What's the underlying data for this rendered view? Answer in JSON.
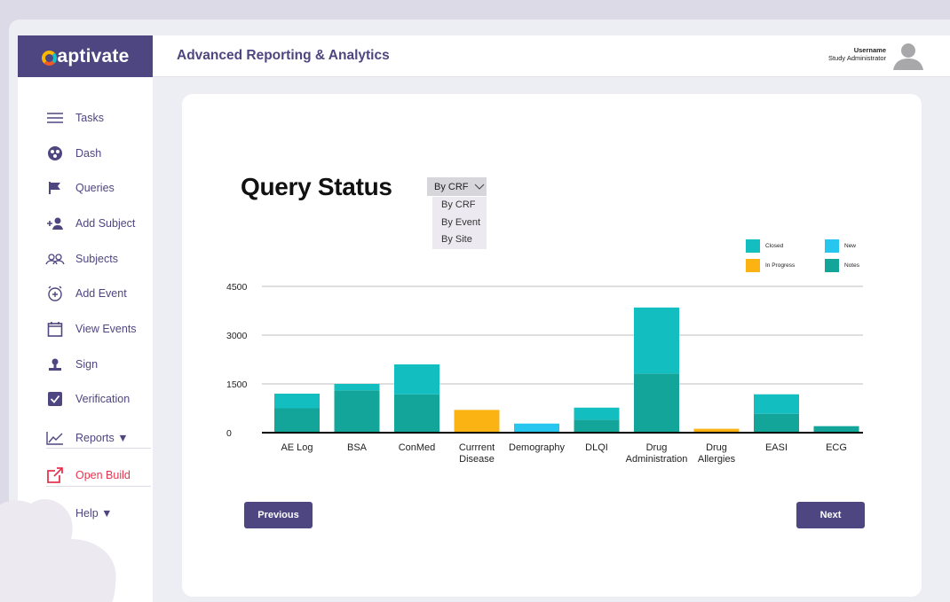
{
  "app": {
    "title": "Advanced Reporting & Analytics",
    "logo": "captivate"
  },
  "user": {
    "name": "Username",
    "role": "Study Administrator"
  },
  "sidebar": {
    "items": [
      {
        "label": "Tasks",
        "icon": "menu-icon"
      },
      {
        "label": "Dash",
        "icon": "dashboard-icon"
      },
      {
        "label": "Queries",
        "icon": "flag-icon"
      },
      {
        "label": "Add Subject",
        "icon": "add-person-icon"
      },
      {
        "label": "Subjects",
        "icon": "people-icon"
      },
      {
        "label": "Add Event",
        "icon": "add-alarm-icon"
      },
      {
        "label": "View Events",
        "icon": "calendar-icon"
      },
      {
        "label": "Sign",
        "icon": "sign-icon"
      },
      {
        "label": "Verification",
        "icon": "checkbox-icon"
      },
      {
        "label": "Reports ▼",
        "icon": "line-chart-icon"
      },
      {
        "label": "Open Build",
        "icon": "external-link-icon"
      },
      {
        "label": "Help ▼",
        "icon": "help-icon"
      }
    ]
  },
  "main": {
    "title": "Query Status",
    "dropdown": {
      "selected": "By CRF",
      "options": [
        "By CRF",
        "By Event",
        "By Site"
      ]
    },
    "buttons": {
      "previous": "Previous",
      "next": "Next"
    }
  },
  "chart_data": {
    "type": "bar",
    "stacked": true,
    "categories": [
      "AE Log",
      "BSA",
      "ConMed",
      "Currrent Disease",
      "Demography",
      "DLQI",
      "Drug Administration",
      "Drug Allergies",
      "EASI",
      "ECG"
    ],
    "category_lines": [
      [
        "AE Log"
      ],
      [
        "BSA"
      ],
      [
        "ConMed"
      ],
      [
        "Currrent",
        "Disease"
      ],
      [
        "Demography"
      ],
      [
        "DLQI"
      ],
      [
        "Drug",
        "Administration"
      ],
      [
        "Drug",
        "Allergies"
      ],
      [
        "EASI"
      ],
      [
        "ECG"
      ]
    ],
    "series": [
      {
        "name": "Notes",
        "color": "#13a59a",
        "values": [
          750,
          1300,
          1180,
          0,
          0,
          400,
          1820,
          0,
          580,
          200
        ]
      },
      {
        "name": "Closed",
        "color": "#13bec1",
        "values": [
          450,
          200,
          920,
          0,
          0,
          370,
          2030,
          0,
          600,
          0
        ]
      },
      {
        "name": "In Progress",
        "color": "#fbb313",
        "values": [
          0,
          0,
          0,
          700,
          0,
          0,
          0,
          120,
          0,
          0
        ]
      },
      {
        "name": "New",
        "color": "#26c6ef",
        "values": [
          0,
          0,
          0,
          0,
          280,
          0,
          0,
          0,
          0,
          0
        ]
      }
    ],
    "legend": [
      {
        "name": "Closed",
        "color": "#13bec1"
      },
      {
        "name": "New",
        "color": "#26c6ef"
      },
      {
        "name": "In Progress",
        "color": "#fbb313"
      },
      {
        "name": "Notes",
        "color": "#13a59a"
      }
    ],
    "yticks": [
      0,
      1500,
      3000,
      4500
    ],
    "ylim": [
      0,
      4500
    ],
    "grid": true,
    "legend_position": "top-right"
  }
}
